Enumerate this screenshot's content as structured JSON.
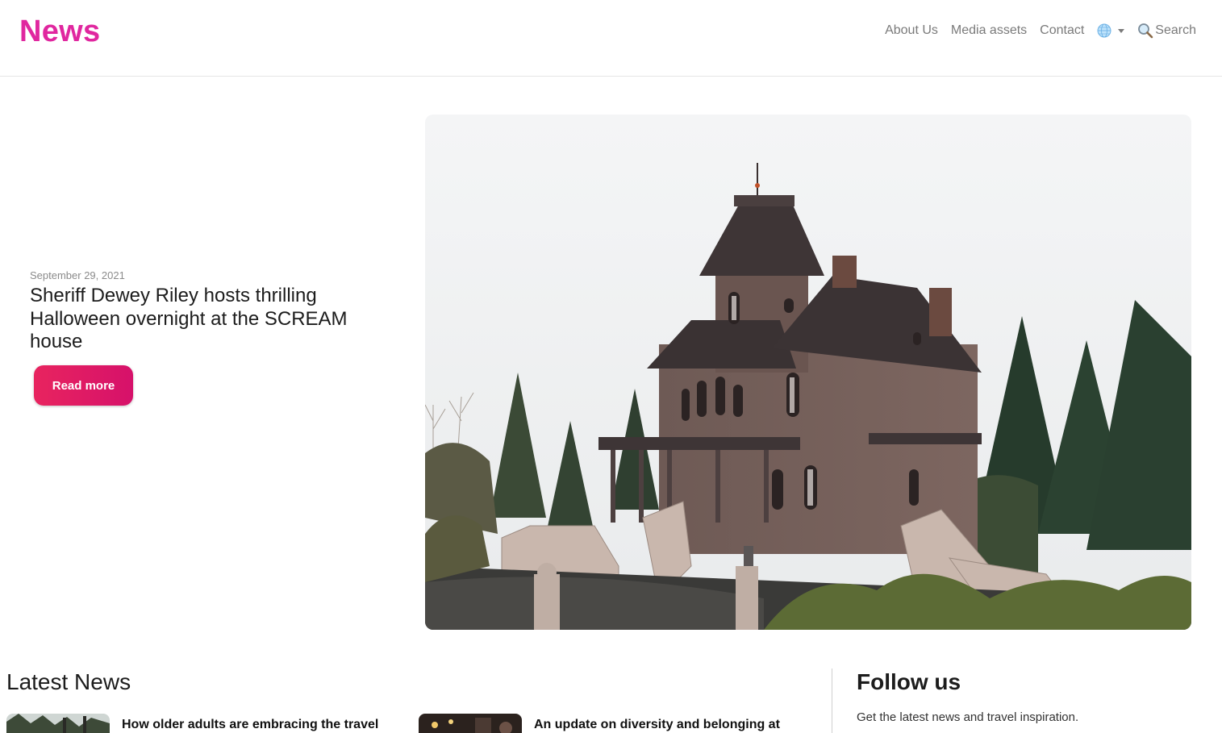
{
  "brand": {
    "logo_text": "News",
    "accent_color": "#e0279f"
  },
  "nav": {
    "items": [
      {
        "label": "About Us"
      },
      {
        "label": "Media assets"
      },
      {
        "label": "Contact"
      }
    ],
    "language_icon": "globe-icon",
    "search_icon": "magnifier-icon",
    "search_label": "Search"
  },
  "hero": {
    "date": "September 29, 2021",
    "title": "Sheriff Dewey Riley hosts thrilling Halloween overnight at the SCREAM house",
    "button_label": "Read more",
    "button_color": "#e0226a"
  },
  "latest_news": {
    "heading": "Latest News",
    "items": [
      {
        "title": "How older adults are embracing the travel"
      },
      {
        "title": "An update on diversity and belonging at"
      }
    ]
  },
  "follow": {
    "heading": "Follow us",
    "subtitle": "Get the latest news and travel inspiration."
  }
}
